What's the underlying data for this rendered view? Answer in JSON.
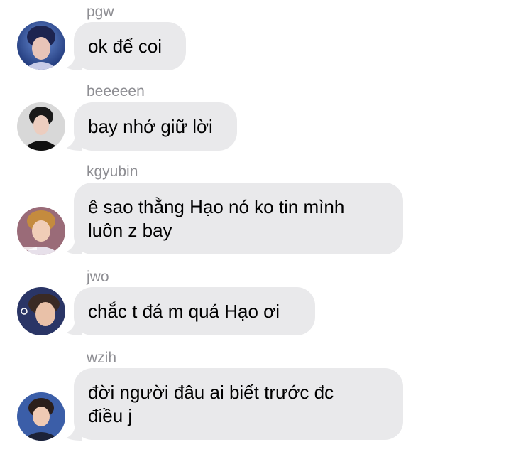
{
  "messages": [
    {
      "sender": "pgw",
      "text": "ok để coi",
      "avatar": "person-avatar-icon"
    },
    {
      "sender": "beeeeen",
      "text": "bay nhớ giữ lời",
      "avatar": "person-avatar-icon"
    },
    {
      "sender": "kgyubin",
      "text": "ê sao thằng Hạo nó ko tin mình\nluôn z bay",
      "avatar": "person-avatar-icon"
    },
    {
      "sender": "jwo",
      "text": "chắc t đá m quá Hạo ơi",
      "avatar": "person-avatar-icon"
    },
    {
      "sender": "wzih",
      "text": "đời người đâu ai biết trước đc\nđiều j",
      "avatar": "person-avatar-icon"
    }
  ],
  "colors": {
    "bubble": "#e9e9eb",
    "sender_name": "#8e8e93",
    "text": "#000000"
  }
}
